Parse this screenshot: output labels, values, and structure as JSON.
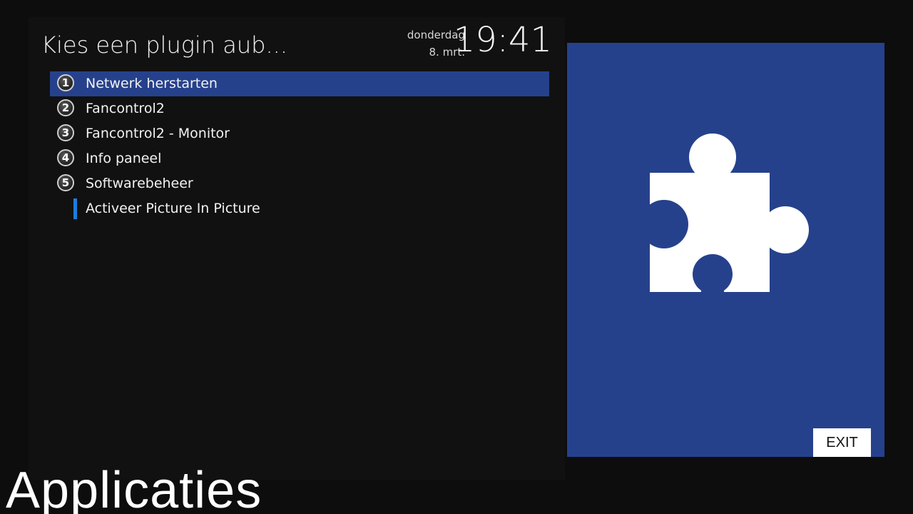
{
  "header": {
    "title": "Kies een plugin aub...",
    "day": "donderdag",
    "date": "8. mrt.",
    "time": "19:41"
  },
  "plugins": [
    {
      "number": "1",
      "label": "Netwerk herstarten",
      "selected": true
    },
    {
      "number": "2",
      "label": "Fancontrol2",
      "selected": false
    },
    {
      "number": "3",
      "label": "Fancontrol2 - Monitor",
      "selected": false
    },
    {
      "number": "4",
      "label": "Info paneel",
      "selected": false
    },
    {
      "number": "5",
      "label": "Softwarebeheer",
      "selected": false
    },
    {
      "number": "",
      "label": "Activeer Picture In Picture",
      "selected": false
    }
  ],
  "preview": {
    "icon": "puzzle-piece-icon",
    "exit_label": "EXIT"
  },
  "footer": {
    "section_title": "Applicaties"
  },
  "colors": {
    "selection": "#26418c",
    "preview_background": "#26418c",
    "marker_blue": "#1a7fe0"
  }
}
